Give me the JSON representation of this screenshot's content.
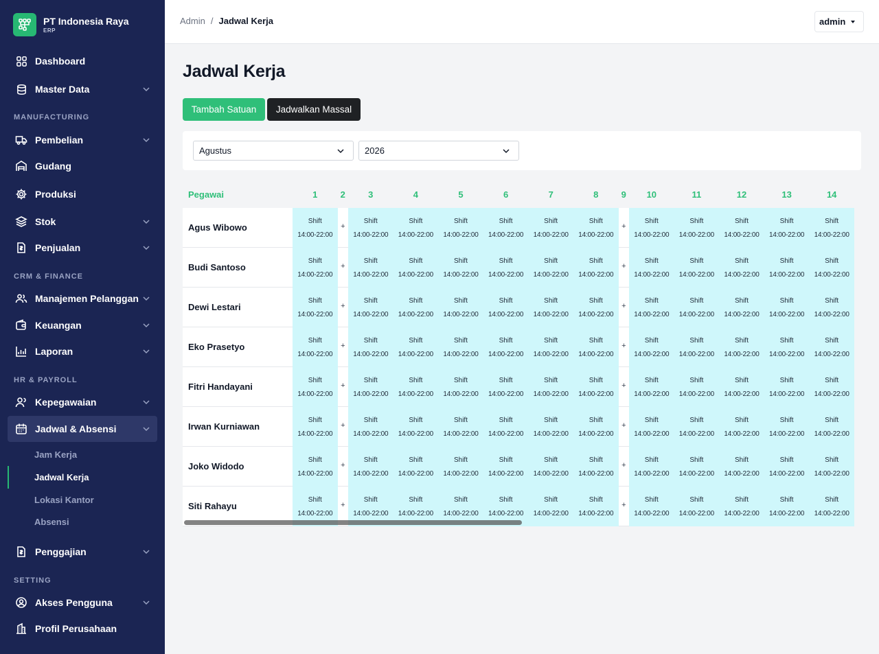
{
  "brand": {
    "name": "PT Indonesia Raya",
    "sub": "ERP"
  },
  "nav": {
    "dashboard": "Dashboard",
    "master_data": "Master Data",
    "sec_manufacturing": "MANUFACTURING",
    "pembelian": "Pembelian",
    "gudang": "Gudang",
    "produksi": "Produksi",
    "stok": "Stok",
    "penjualan": "Penjualan",
    "sec_crm": "CRM & FINANCE",
    "manajemen_pelanggan": "Manajemen Pelanggan",
    "keuangan": "Keuangan",
    "laporan": "Laporan",
    "sec_hr": "HR & PAYROLL",
    "kepegawaian": "Kepegawaian",
    "jadwal_absensi": "Jadwal & Absensi",
    "sub_jam_kerja": "Jam Kerja",
    "sub_jadwal_kerja": "Jadwal Kerja",
    "sub_lokasi_kantor": "Lokasi Kantor",
    "sub_absensi": "Absensi",
    "penggajian": "Penggajian",
    "sec_setting": "SETTING",
    "akses_pengguna": "Akses Pengguna",
    "profil_perusahaan": "Profil Perusahaan"
  },
  "topbar": {
    "crumb_root": "Admin",
    "crumb_sep": "/",
    "crumb_current": "Jadwal Kerja",
    "user": "admin"
  },
  "page": {
    "title": "Jadwal Kerja",
    "btn_add_single": "Tambah Satuan",
    "btn_bulk": "Jadwalkan Massal"
  },
  "filters": {
    "month": "Agustus",
    "year": "2026"
  },
  "schedule": {
    "employee_header": "Pegawai",
    "days": [
      "1",
      "2",
      "3",
      "4",
      "5",
      "6",
      "7",
      "8",
      "9",
      "10",
      "11",
      "12",
      "13",
      "14"
    ],
    "empty_days": [
      "2",
      "9"
    ],
    "shift_label": "Shift",
    "shift_time": "14:00-22:00",
    "empty_label": "+",
    "employees": [
      "Agus Wibowo",
      "Budi Santoso",
      "Dewi Lestari",
      "Eko Prasetyo",
      "Fitri Handayani",
      "Irwan Kurniawan",
      "Joko Widodo",
      "Siti Rahayu"
    ]
  },
  "colors": {
    "sidebar": "#1b2553",
    "accent_green": "#2fbf79",
    "shift_cell": "#cff7fb",
    "dark_button": "#1f2124"
  }
}
